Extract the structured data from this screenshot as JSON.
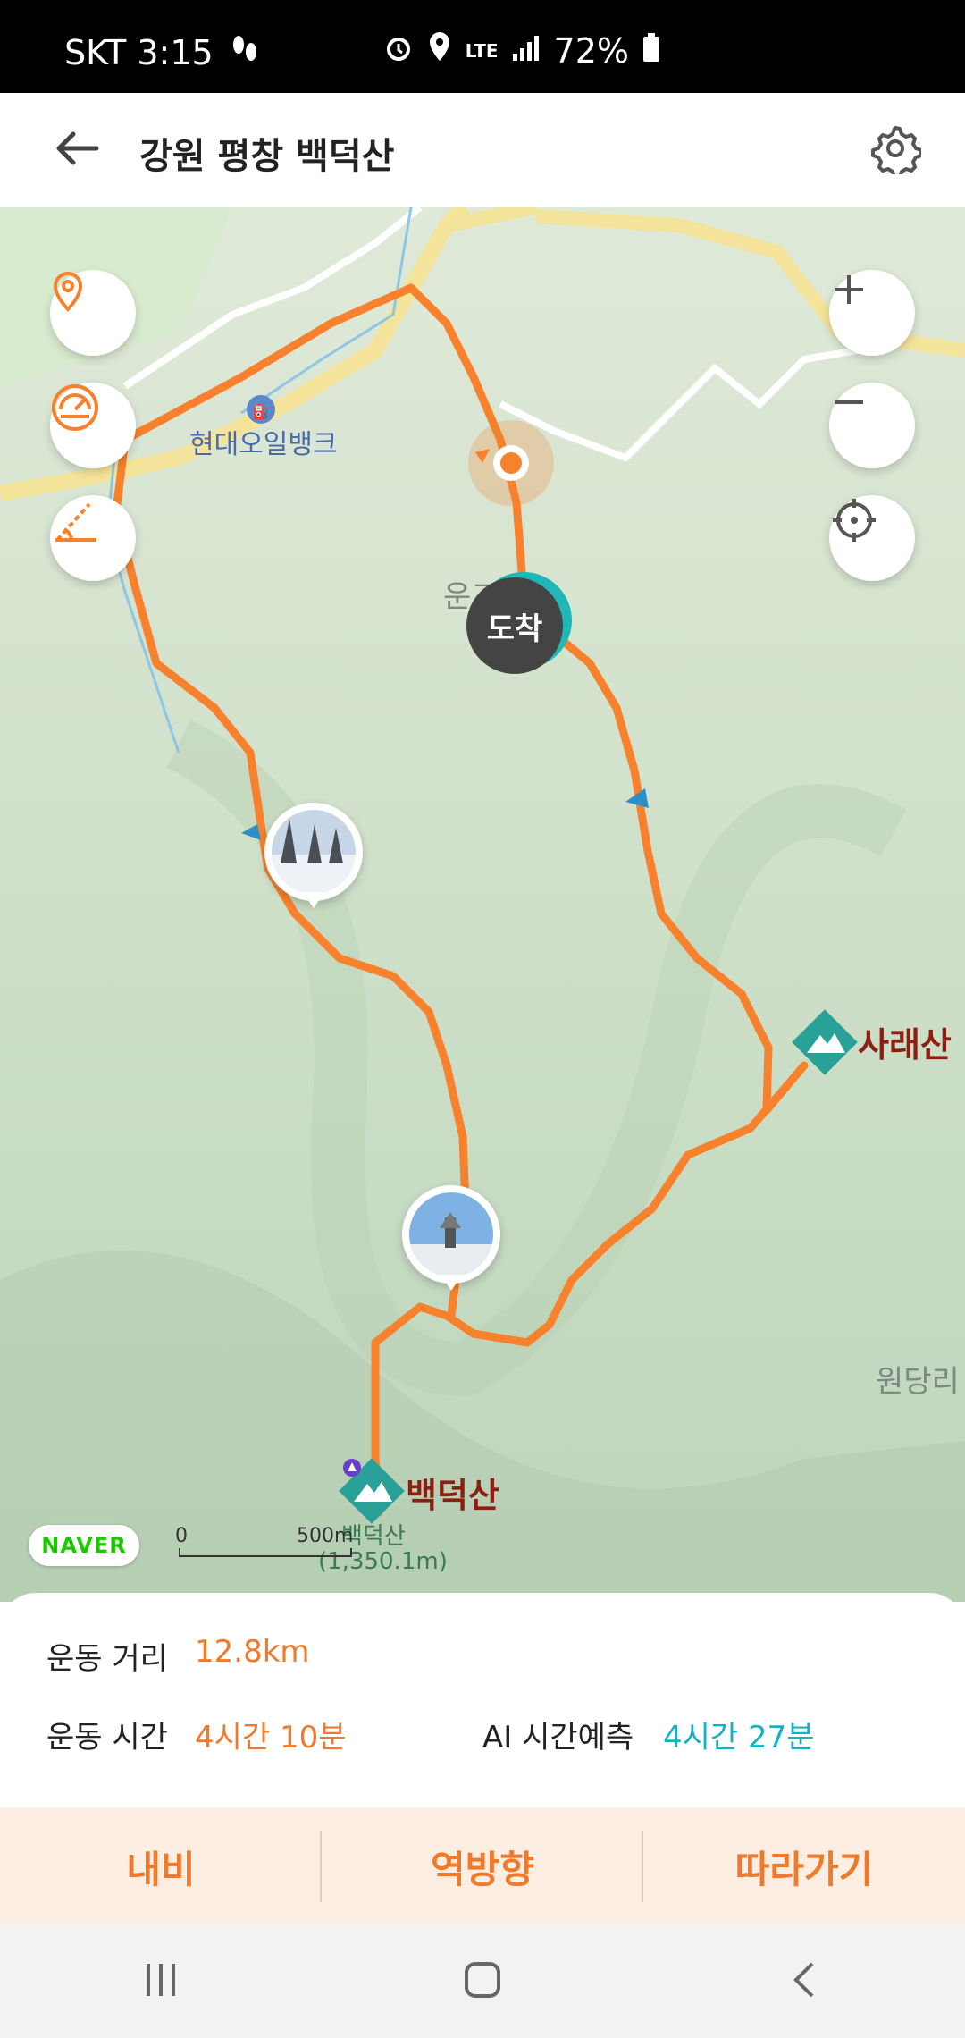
{
  "status_bar": {
    "carrier_time": "SKT 3:15",
    "battery": "72%"
  },
  "header": {
    "title": "강원 평창 백덕산",
    "back_icon": "arrow-left-icon",
    "settings_icon": "gear-icon"
  },
  "map": {
    "places": {
      "hyundai_oil": "현대오일뱅크",
      "ungyo": "운교리",
      "wondang": "원당리"
    },
    "peaks": {
      "sarae": "사래산",
      "baekdeok": "백덕산",
      "baekdeok_sub": "백덕산",
      "baekdeok_elev": "(1,350.1m)"
    },
    "arrival": "도착",
    "scale": {
      "zero": "0",
      "dist": "500m"
    },
    "logo": "NAVER",
    "route_color": "#f7812c"
  },
  "summary": {
    "distance_label": "운동 거리",
    "distance_value": "12.8km",
    "time_label": "운동 시간",
    "time_value": "4시간 10분",
    "ai_label": "AI 시간예측",
    "ai_value": "4시간 27분"
  },
  "actions": {
    "navi": "내비",
    "reverse": "역방향",
    "follow": "따라가기"
  }
}
